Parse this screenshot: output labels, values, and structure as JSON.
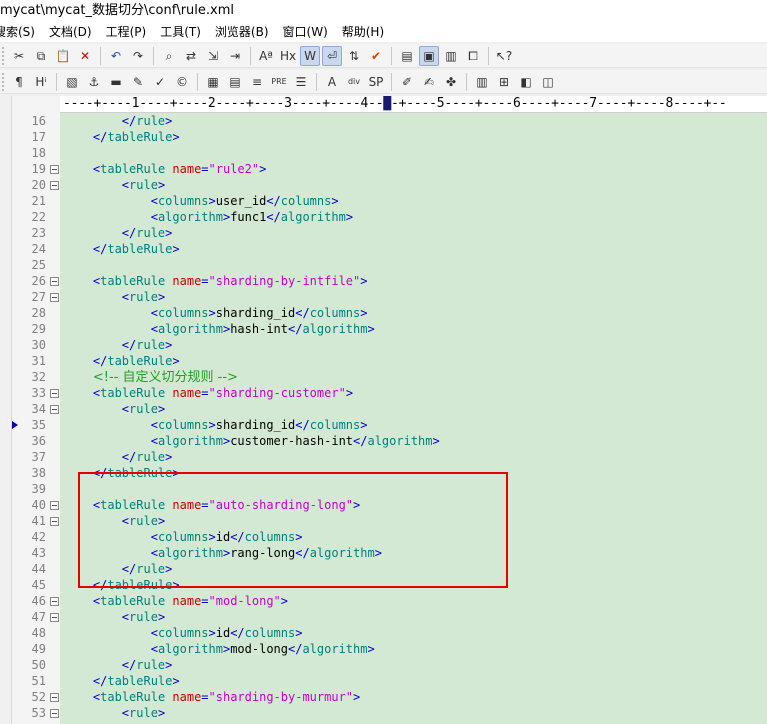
{
  "window": {
    "title": "mycat\\mycat_数据切分\\conf\\rule.xml"
  },
  "menu": [
    {
      "id": "search",
      "label": "搜索(S)"
    },
    {
      "id": "document",
      "label": "文档(D)"
    },
    {
      "id": "project",
      "label": "工程(P)"
    },
    {
      "id": "tools",
      "label": "工具(T)"
    },
    {
      "id": "browser",
      "label": "浏览器(B)"
    },
    {
      "id": "window",
      "label": "窗口(W)"
    },
    {
      "id": "help",
      "label": "帮助(H)"
    }
  ],
  "toolbar1": [
    {
      "icon": "cut-icon",
      "glyph": "✂"
    },
    {
      "icon": "copy-icon",
      "glyph": "⧉"
    },
    {
      "icon": "paste-icon",
      "glyph": "📋"
    },
    {
      "icon": "delete-icon",
      "glyph": "✕",
      "color": "#cc0000"
    },
    {
      "icon": "undo-icon",
      "glyph": "↶",
      "color": "#1f4fa8"
    },
    {
      "icon": "redo-icon",
      "glyph": "↷"
    },
    {
      "icon": "find-icon",
      "glyph": "⌕"
    },
    {
      "icon": "replace-icon",
      "glyph": "⇄"
    },
    {
      "icon": "jump-icon",
      "glyph": "⇲"
    },
    {
      "icon": "indent-icon",
      "glyph": "⇥"
    },
    {
      "icon": "font-icon",
      "glyph": "Aª"
    },
    {
      "icon": "hx-icon",
      "glyph": "Hx"
    },
    {
      "icon": "wordwrap-icon",
      "glyph": "W",
      "active": true
    },
    {
      "icon": "linebreak-icon",
      "glyph": "⏎",
      "active": true
    },
    {
      "icon": "sort-icon",
      "glyph": "⇅"
    },
    {
      "icon": "spellcheck-icon",
      "glyph": "✔",
      "color": "#e04000"
    },
    {
      "icon": "list-icon",
      "glyph": "▤"
    },
    {
      "icon": "view-active-icon",
      "glyph": "▣",
      "active": true
    },
    {
      "icon": "panel-icon",
      "glyph": "▥"
    },
    {
      "icon": "window-icon",
      "glyph": "⧠"
    },
    {
      "icon": "help-cursor-icon",
      "glyph": "↖?"
    }
  ],
  "toolbar2": [
    {
      "icon": "paragraph-icon",
      "glyph": "¶"
    },
    {
      "icon": "heading-icon",
      "glyph": "Hⁱ"
    },
    {
      "icon": "image-icon",
      "glyph": "▧"
    },
    {
      "icon": "anchor-icon",
      "glyph": "⚓"
    },
    {
      "icon": "hr-icon",
      "glyph": "▬"
    },
    {
      "icon": "edit-icon",
      "glyph": "✎"
    },
    {
      "icon": "check-icon",
      "glyph": "✓"
    },
    {
      "icon": "copyright-icon",
      "glyph": "©"
    },
    {
      "icon": "table-icon",
      "glyph": "▦"
    },
    {
      "icon": "form-icon",
      "glyph": "▤"
    },
    {
      "icon": "center-icon",
      "glyph": "≡"
    },
    {
      "icon": "pre-icon",
      "glyph": "PRE"
    },
    {
      "icon": "bullets-icon",
      "glyph": "☰"
    },
    {
      "icon": "bold-a-icon",
      "glyph": "A"
    },
    {
      "icon": "div-icon",
      "glyph": "div"
    },
    {
      "icon": "sp-icon",
      "glyph": "SP"
    },
    {
      "icon": "pen-icon",
      "glyph": "✐"
    },
    {
      "icon": "brush-icon",
      "glyph": "✍"
    },
    {
      "icon": "palette-icon",
      "glyph": "✤"
    },
    {
      "icon": "layout-icon",
      "glyph": "▥"
    },
    {
      "icon": "grid-icon",
      "glyph": "⊞"
    },
    {
      "icon": "preview-icon",
      "glyph": "◧"
    },
    {
      "icon": "split-icon",
      "glyph": "◫"
    }
  ],
  "ruler": "----+----1----+----2----+----3----+----4--█-+----5----+----6----+----7----+----8----+--",
  "lines": [
    {
      "n": "16",
      "fold": false,
      "indent": "        ",
      "parts": [
        [
          "pb",
          "</"
        ],
        [
          "tg",
          "rule"
        ],
        [
          "pb",
          ">"
        ]
      ]
    },
    {
      "n": "17",
      "fold": false,
      "indent": "    ",
      "parts": [
        [
          "pb",
          "</"
        ],
        [
          "tg",
          "tableRule"
        ],
        [
          "pb",
          ">"
        ]
      ]
    },
    {
      "n": "18",
      "fold": false,
      "indent": "",
      "parts": []
    },
    {
      "n": "19",
      "fold": true,
      "indent": "    ",
      "parts": [
        [
          "pb",
          "<"
        ],
        [
          "tg",
          "tableRule "
        ],
        [
          "at",
          "name"
        ],
        [
          "pb",
          "="
        ],
        [
          "vl",
          "\"rule2\""
        ],
        [
          "pb",
          ">"
        ]
      ]
    },
    {
      "n": "20",
      "fold": true,
      "indent": "        ",
      "parts": [
        [
          "pb",
          "<"
        ],
        [
          "tg",
          "rule"
        ],
        [
          "pb",
          ">"
        ]
      ]
    },
    {
      "n": "21",
      "fold": false,
      "indent": "            ",
      "parts": [
        [
          "pb",
          "<"
        ],
        [
          "tg",
          "columns"
        ],
        [
          "pb",
          ">"
        ],
        [
          "tx",
          "user_id"
        ],
        [
          "pb",
          "</"
        ],
        [
          "tg",
          "columns"
        ],
        [
          "pb",
          ">"
        ]
      ]
    },
    {
      "n": "22",
      "fold": false,
      "indent": "            ",
      "parts": [
        [
          "pb",
          "<"
        ],
        [
          "tg",
          "algorithm"
        ],
        [
          "pb",
          ">"
        ],
        [
          "tx",
          "func1"
        ],
        [
          "pb",
          "</"
        ],
        [
          "tg",
          "algorithm"
        ],
        [
          "pb",
          ">"
        ]
      ]
    },
    {
      "n": "23",
      "fold": false,
      "indent": "        ",
      "parts": [
        [
          "pb",
          "</"
        ],
        [
          "tg",
          "rule"
        ],
        [
          "pb",
          ">"
        ]
      ]
    },
    {
      "n": "24",
      "fold": false,
      "indent": "    ",
      "parts": [
        [
          "pb",
          "</"
        ],
        [
          "tg",
          "tableRule"
        ],
        [
          "pb",
          ">"
        ]
      ]
    },
    {
      "n": "25",
      "fold": false,
      "indent": "",
      "parts": []
    },
    {
      "n": "26",
      "fold": true,
      "indent": "    ",
      "parts": [
        [
          "pb",
          "<"
        ],
        [
          "tg",
          "tableRule "
        ],
        [
          "at",
          "name"
        ],
        [
          "pb",
          "="
        ],
        [
          "vl",
          "\"sharding-by-intfile\""
        ],
        [
          "pb",
          ">"
        ]
      ]
    },
    {
      "n": "27",
      "fold": true,
      "indent": "        ",
      "parts": [
        [
          "pb",
          "<"
        ],
        [
          "tg",
          "rule"
        ],
        [
          "pb",
          ">"
        ]
      ]
    },
    {
      "n": "28",
      "fold": false,
      "indent": "            ",
      "parts": [
        [
          "pb",
          "<"
        ],
        [
          "tg",
          "columns"
        ],
        [
          "pb",
          ">"
        ],
        [
          "tx",
          "sharding_id"
        ],
        [
          "pb",
          "</"
        ],
        [
          "tg",
          "columns"
        ],
        [
          "pb",
          ">"
        ]
      ]
    },
    {
      "n": "29",
      "fold": false,
      "indent": "            ",
      "parts": [
        [
          "pb",
          "<"
        ],
        [
          "tg",
          "algorithm"
        ],
        [
          "pb",
          ">"
        ],
        [
          "tx",
          "hash-int"
        ],
        [
          "pb",
          "</"
        ],
        [
          "tg",
          "algorithm"
        ],
        [
          "pb",
          ">"
        ]
      ]
    },
    {
      "n": "30",
      "fold": false,
      "indent": "        ",
      "parts": [
        [
          "pb",
          "</"
        ],
        [
          "tg",
          "rule"
        ],
        [
          "pb",
          ">"
        ]
      ]
    },
    {
      "n": "31",
      "fold": false,
      "indent": "    ",
      "parts": [
        [
          "pb",
          "</"
        ],
        [
          "tg",
          "tableRule"
        ],
        [
          "pb",
          ">"
        ]
      ]
    },
    {
      "n": "32",
      "fold": false,
      "indent": "    ",
      "parts": [
        [
          "cm",
          "<!-- 自定义切分规则 -->"
        ]
      ]
    },
    {
      "n": "33",
      "fold": true,
      "indent": "    ",
      "parts": [
        [
          "pb",
          "<"
        ],
        [
          "tg",
          "tableRule "
        ],
        [
          "at",
          "name"
        ],
        [
          "pb",
          "="
        ],
        [
          "vl",
          "\"sharding-customer\""
        ],
        [
          "pb",
          ">"
        ]
      ]
    },
    {
      "n": "34",
      "fold": true,
      "indent": "        ",
      "parts": [
        [
          "pb",
          "<"
        ],
        [
          "tg",
          "rule"
        ],
        [
          "pb",
          ">"
        ]
      ]
    },
    {
      "n": "35",
      "fold": false,
      "indent": "            ",
      "marker": true,
      "parts": [
        [
          "pb",
          "<"
        ],
        [
          "tg",
          "columns"
        ],
        [
          "pb",
          ">"
        ],
        [
          "tx",
          "sharding_id"
        ],
        [
          "pb",
          "</"
        ],
        [
          "tg",
          "columns"
        ],
        [
          "pb",
          ">"
        ]
      ]
    },
    {
      "n": "36",
      "fold": false,
      "indent": "            ",
      "parts": [
        [
          "pb",
          "<"
        ],
        [
          "tg",
          "algorithm"
        ],
        [
          "pb",
          ">"
        ],
        [
          "tx",
          "customer-hash-int"
        ],
        [
          "pb",
          "</"
        ],
        [
          "tg",
          "algorithm"
        ],
        [
          "pb",
          ">"
        ]
      ]
    },
    {
      "n": "37",
      "fold": false,
      "indent": "        ",
      "parts": [
        [
          "pb",
          "</"
        ],
        [
          "tg",
          "rule"
        ],
        [
          "pb",
          ">"
        ]
      ]
    },
    {
      "n": "38",
      "fold": false,
      "indent": "    ",
      "parts": [
        [
          "pb",
          "</"
        ],
        [
          "tg",
          "tableRule"
        ],
        [
          "pb",
          ">"
        ]
      ]
    },
    {
      "n": "39",
      "fold": false,
      "indent": "",
      "parts": []
    },
    {
      "n": "40",
      "fold": true,
      "indent": "    ",
      "parts": [
        [
          "pb",
          "<"
        ],
        [
          "tg",
          "tableRule "
        ],
        [
          "at",
          "name"
        ],
        [
          "pb",
          "="
        ],
        [
          "vl",
          "\"auto-sharding-long\""
        ],
        [
          "pb",
          ">"
        ]
      ]
    },
    {
      "n": "41",
      "fold": true,
      "indent": "        ",
      "parts": [
        [
          "pb",
          "<"
        ],
        [
          "tg",
          "rule"
        ],
        [
          "pb",
          ">"
        ]
      ]
    },
    {
      "n": "42",
      "fold": false,
      "indent": "            ",
      "parts": [
        [
          "pb",
          "<"
        ],
        [
          "tg",
          "columns"
        ],
        [
          "pb",
          ">"
        ],
        [
          "tx",
          "id"
        ],
        [
          "pb",
          "</"
        ],
        [
          "tg",
          "columns"
        ],
        [
          "pb",
          ">"
        ]
      ]
    },
    {
      "n": "43",
      "fold": false,
      "indent": "            ",
      "parts": [
        [
          "pb",
          "<"
        ],
        [
          "tg",
          "algorithm"
        ],
        [
          "pb",
          ">"
        ],
        [
          "tx",
          "rang-long"
        ],
        [
          "pb",
          "</"
        ],
        [
          "tg",
          "algorithm"
        ],
        [
          "pb",
          ">"
        ]
      ]
    },
    {
      "n": "44",
      "fold": false,
      "indent": "        ",
      "parts": [
        [
          "pb",
          "</"
        ],
        [
          "tg",
          "rule"
        ],
        [
          "pb",
          ">"
        ]
      ]
    },
    {
      "n": "45",
      "fold": false,
      "indent": "    ",
      "parts": [
        [
          "pb",
          "</"
        ],
        [
          "tg",
          "tableRule"
        ],
        [
          "pb",
          ">"
        ]
      ]
    },
    {
      "n": "46",
      "fold": true,
      "indent": "    ",
      "parts": [
        [
          "pb",
          "<"
        ],
        [
          "tg",
          "tableRule "
        ],
        [
          "at",
          "name"
        ],
        [
          "pb",
          "="
        ],
        [
          "vl",
          "\"mod-long\""
        ],
        [
          "pb",
          ">"
        ]
      ]
    },
    {
      "n": "47",
      "fold": true,
      "indent": "        ",
      "parts": [
        [
          "pb",
          "<"
        ],
        [
          "tg",
          "rule"
        ],
        [
          "pb",
          ">"
        ]
      ]
    },
    {
      "n": "48",
      "fold": false,
      "indent": "            ",
      "parts": [
        [
          "pb",
          "<"
        ],
        [
          "tg",
          "columns"
        ],
        [
          "pb",
          ">"
        ],
        [
          "tx",
          "id"
        ],
        [
          "pb",
          "</"
        ],
        [
          "tg",
          "columns"
        ],
        [
          "pb",
          ">"
        ]
      ]
    },
    {
      "n": "49",
      "fold": false,
      "indent": "            ",
      "parts": [
        [
          "pb",
          "<"
        ],
        [
          "tg",
          "algorithm"
        ],
        [
          "pb",
          ">"
        ],
        [
          "tx",
          "mod-long"
        ],
        [
          "pb",
          "</"
        ],
        [
          "tg",
          "algorithm"
        ],
        [
          "pb",
          ">"
        ]
      ]
    },
    {
      "n": "50",
      "fold": false,
      "indent": "        ",
      "parts": [
        [
          "pb",
          "</"
        ],
        [
          "tg",
          "rule"
        ],
        [
          "pb",
          ">"
        ]
      ]
    },
    {
      "n": "51",
      "fold": false,
      "indent": "    ",
      "parts": [
        [
          "pb",
          "</"
        ],
        [
          "tg",
          "tableRule"
        ],
        [
          "pb",
          ">"
        ]
      ]
    },
    {
      "n": "52",
      "fold": true,
      "indent": "    ",
      "parts": [
        [
          "pb",
          "<"
        ],
        [
          "tg",
          "tableRule "
        ],
        [
          "at",
          "name"
        ],
        [
          "pb",
          "="
        ],
        [
          "vl",
          "\"sharding-by-murmur\""
        ],
        [
          "pb",
          ">"
        ]
      ]
    },
    {
      "n": "53",
      "fold": true,
      "indent": "        ",
      "parts": [
        [
          "pb",
          "<"
        ],
        [
          "tg",
          "rule"
        ],
        [
          "pb",
          ">"
        ]
      ]
    }
  ]
}
